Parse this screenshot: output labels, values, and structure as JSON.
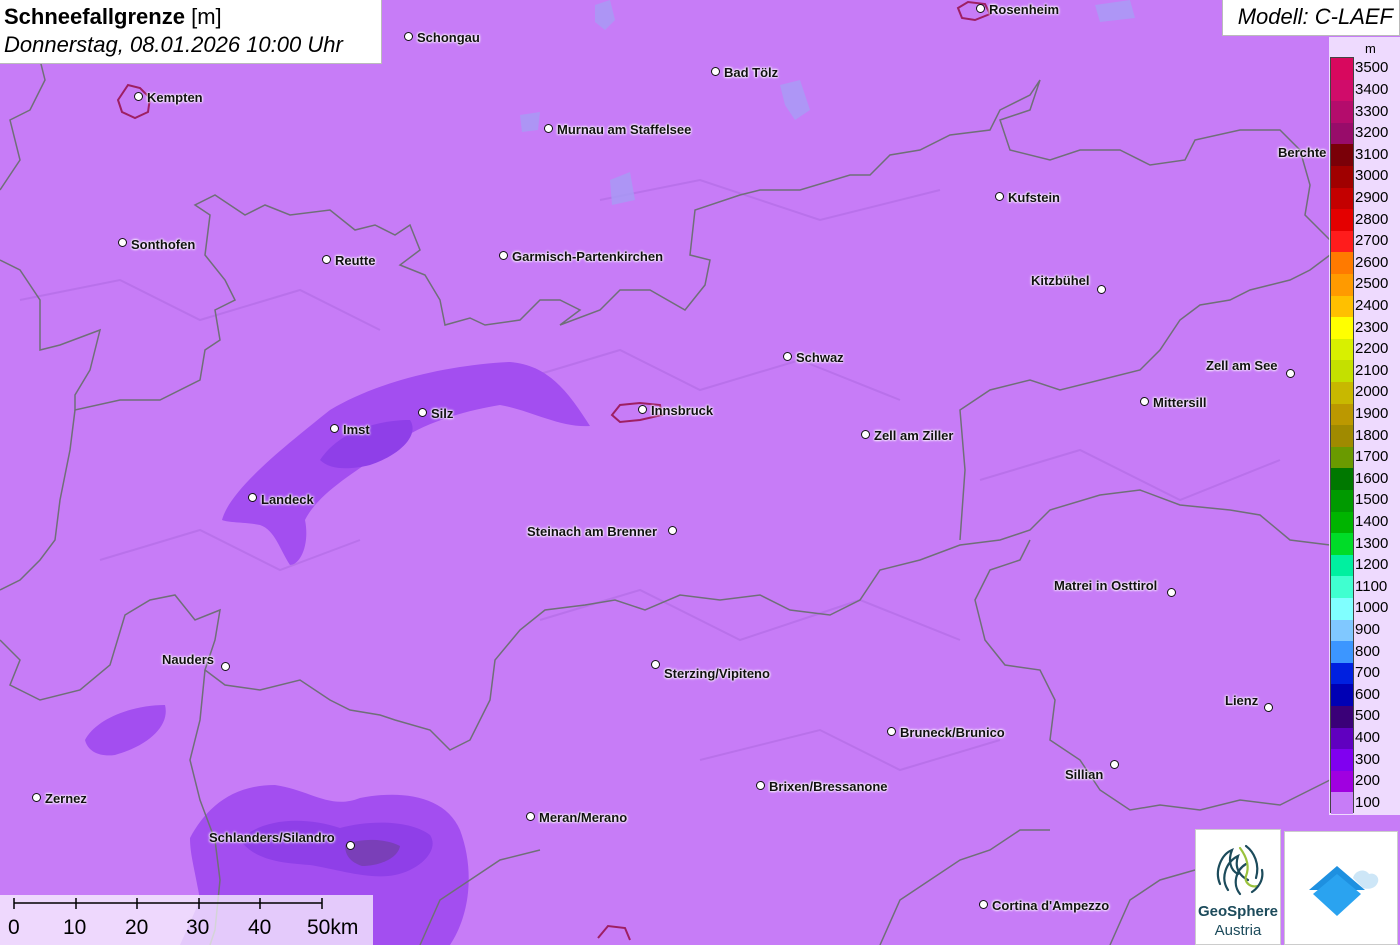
{
  "header": {
    "title": "Schneefallgrenze",
    "unit": "[m]",
    "subtitle": "Donnerstag, 08.01.2026 10:00 Uhr",
    "model": "Modell: C-LAEF"
  },
  "legend": {
    "unit": "m",
    "entries": [
      {
        "label": "3500",
        "color": "#d8085e"
      },
      {
        "label": "3400",
        "color": "#d00c6a"
      },
      {
        "label": "3300",
        "color": "#b40c6c"
      },
      {
        "label": "3200",
        "color": "#980c6a"
      },
      {
        "label": "3100",
        "color": "#7a0008"
      },
      {
        "label": "3000",
        "color": "#a00000"
      },
      {
        "label": "2900",
        "color": "#c40000"
      },
      {
        "label": "2800",
        "color": "#e40000"
      },
      {
        "label": "2700",
        "color": "#ff1c1c"
      },
      {
        "label": "2600",
        "color": "#ff7a00"
      },
      {
        "label": "2500",
        "color": "#ff9a00"
      },
      {
        "label": "2400",
        "color": "#ffc000"
      },
      {
        "label": "2300",
        "color": "#ffff00"
      },
      {
        "label": "2200",
        "color": "#d8f000"
      },
      {
        "label": "2100",
        "color": "#c4e000"
      },
      {
        "label": "2000",
        "color": "#c8b800"
      },
      {
        "label": "1900",
        "color": "#bc9800"
      },
      {
        "label": "1800",
        "color": "#a08a00"
      },
      {
        "label": "1700",
        "color": "#6a9a00"
      },
      {
        "label": "1600",
        "color": "#007800"
      },
      {
        "label": "1500",
        "color": "#009a00"
      },
      {
        "label": "1400",
        "color": "#00b400"
      },
      {
        "label": "1300",
        "color": "#00dc28"
      },
      {
        "label": "1200",
        "color": "#00f0a0"
      },
      {
        "label": "1100",
        "color": "#40ffd0"
      },
      {
        "label": "1000",
        "color": "#80ffff"
      },
      {
        "label": "900",
        "color": "#80c8ff"
      },
      {
        "label": "800",
        "color": "#3c96ff"
      },
      {
        "label": "700",
        "color": "#0020e0"
      },
      {
        "label": "600",
        "color": "#0000b4"
      },
      {
        "label": "500",
        "color": "#3a0078"
      },
      {
        "label": "400",
        "color": "#6000c0"
      },
      {
        "label": "300",
        "color": "#8000f0"
      },
      {
        "label": "200",
        "color": "#a000e0"
      },
      {
        "label": "100",
        "color": "#c77cf7"
      }
    ]
  },
  "cities": [
    {
      "name": "Schongau"
    },
    {
      "name": "Rosenheim"
    },
    {
      "name": "Kempten"
    },
    {
      "name": "Bad Tölz"
    },
    {
      "name": "Murnau am Staffelsee"
    },
    {
      "name": "Berchte"
    },
    {
      "name": "Kufstein"
    },
    {
      "name": "Sonthofen"
    },
    {
      "name": "Reutte"
    },
    {
      "name": "Garmisch-Partenkirchen"
    },
    {
      "name": "Kitzbühel"
    },
    {
      "name": "Schwaz"
    },
    {
      "name": "Zell am See"
    },
    {
      "name": "Mittersill"
    },
    {
      "name": "Innsbruck"
    },
    {
      "name": "Imst"
    },
    {
      "name": "Silz"
    },
    {
      "name": "Zell am Ziller"
    },
    {
      "name": "Landeck"
    },
    {
      "name": "Steinach am Brenner"
    },
    {
      "name": "Matrei in Osttirol"
    },
    {
      "name": "Nauders"
    },
    {
      "name": "Sterzing/Vipiteno"
    },
    {
      "name": "Lienz"
    },
    {
      "name": "Bruneck/Brunico"
    },
    {
      "name": "Sillian"
    },
    {
      "name": "Zernez"
    },
    {
      "name": "Brixen/Bressanone"
    },
    {
      "name": "Meran/Merano"
    },
    {
      "name": "Schlanders/Silandro"
    },
    {
      "name": "Cortina d'Ampezzo"
    }
  ],
  "scalebar": {
    "labels": [
      "0",
      "10",
      "20",
      "30",
      "40",
      "50km"
    ]
  },
  "logos": {
    "geosphere_line1": "GeoSphere",
    "geosphere_line2": "Austria"
  },
  "colors": {
    "base_field": "#c77cf7",
    "mid_field": "#a34ef0",
    "low_field": "#8833e6",
    "border": "#6f6f78",
    "city_outline": "#9e1f63"
  }
}
